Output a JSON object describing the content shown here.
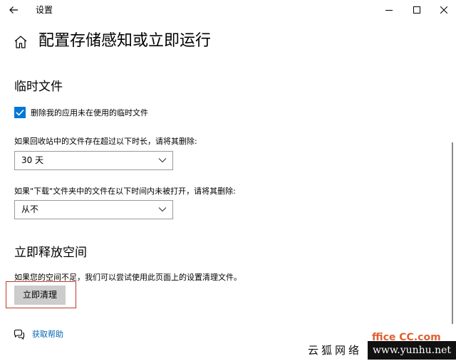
{
  "window": {
    "title": "设置"
  },
  "page": {
    "title": "配置存储感知或立即运行"
  },
  "temp_files": {
    "heading": "临时文件",
    "checkbox_label": "删除我的应用未在使用的临时文件",
    "checkbox_checked": true,
    "recycle_label": "如果回收站中的文件存在超过以下时长，请将其删除:",
    "recycle_value": "30 天",
    "download_label": "如果\"下载\"文件夹中的文件在以下时间内未被打开，请将其删除:",
    "download_value": "从不"
  },
  "free_space": {
    "heading": "立即释放空间",
    "description": "如果您的空间不足，我们可以尝试使用此页面上的设置清理文件。",
    "button_label": "立即清理"
  },
  "help": {
    "link_label": "获取帮助"
  },
  "watermark": {
    "partial_text": "ffice  CC.com",
    "cn_text": "云狐网络",
    "url_text": "www.yunhu.net"
  },
  "colors": {
    "accent": "#0078d7",
    "link": "#0067b8",
    "button_bg": "#cccccc",
    "highlight_border": "#c0392b"
  },
  "icons": {
    "back": "back-arrow-icon",
    "minimize": "minimize-icon",
    "maximize": "maximize-icon",
    "close": "close-icon",
    "home": "home-icon",
    "check": "checkmark-icon",
    "chevron": "chevron-down-icon",
    "help": "help-chat-icon"
  }
}
